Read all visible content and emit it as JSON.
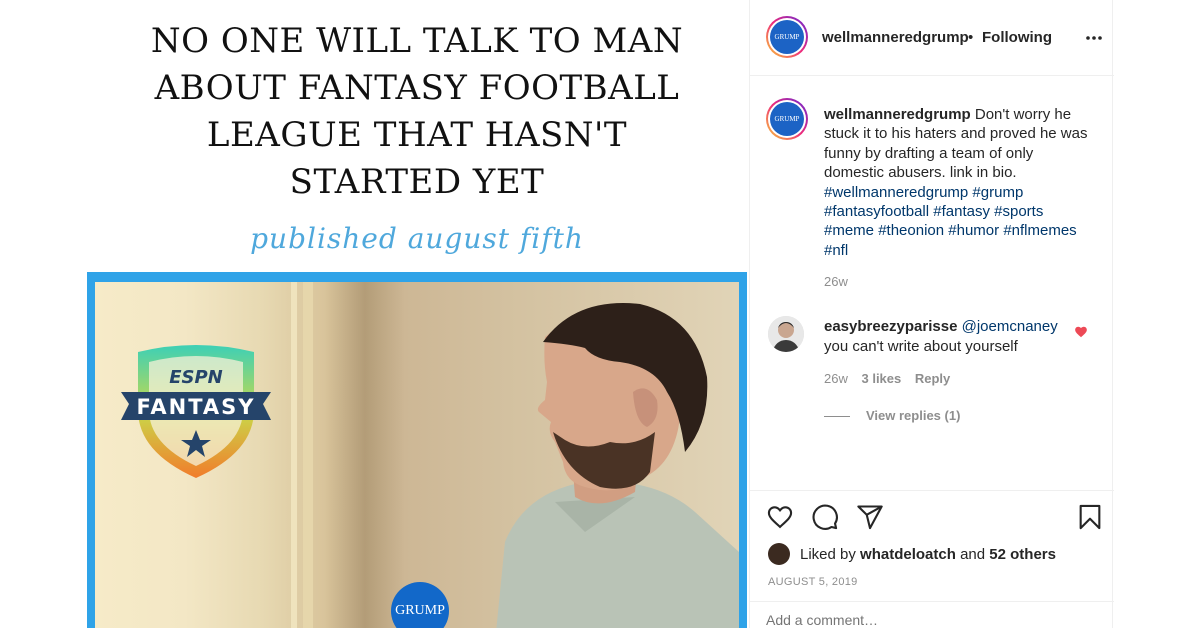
{
  "post_image": {
    "headline": "NO ONE WILL TALK TO MAN ABOUT FANTASY FOOTBALL LEAGUE THAT HASN'T STARTED YET",
    "headline_lines": [
      "NO ONE WILL TALK TO MAN",
      "ABOUT FANTASY FOOTBALL",
      "LEAGUE THAT HASN'T",
      "STARTED YET"
    ],
    "subline": "published august fifth",
    "badge_brand": "ESPN",
    "badge_text": "FANTASY",
    "logo_text": "GRUMP",
    "frame_color": "#2fa3e8",
    "subline_color": "#4fa8dc"
  },
  "header": {
    "avatar_text": "GRUMP",
    "username": "wellmanneredgrump",
    "separator": "•",
    "follow_status": "Following",
    "more_icon": "more-horizontal-icon"
  },
  "caption": {
    "avatar_text": "GRUMP",
    "username": "wellmanneredgrump",
    "text": "Don't worry he stuck it to his haters and proved he was funny by drafting a team of only domestic abusers. link in bio.",
    "hashtags": [
      "#wellmanneredgrump",
      "#grump",
      "#fantasyfootball",
      "#fantasy",
      "#sports",
      "#meme",
      "#theonion",
      "#humor",
      "#nflmemes",
      "#nfl"
    ],
    "time": "26w"
  },
  "comment": {
    "username": "easybreezyparisse",
    "mention": "@joemcnaney",
    "text": "you can't write about yourself",
    "time": "26w",
    "likes": "3 likes",
    "reply_label": "Reply",
    "view_replies": "View replies (1)",
    "liked": true,
    "heart_color": "#ed4956"
  },
  "actions": {
    "icons": [
      "heart-outline-icon",
      "comment-bubble-icon",
      "share-send-icon",
      "bookmark-icon"
    ],
    "liked_by_prefix": "Liked by",
    "liked_by_user": "whatdeloatch",
    "liked_by_and": "and",
    "liked_by_others": "52 others",
    "date": "AUGUST 5, 2019"
  },
  "add_comment": {
    "placeholder": "Add a comment…"
  },
  "colors": {
    "link": "#00376b",
    "muted": "#8e8e8e",
    "text": "#262626"
  }
}
